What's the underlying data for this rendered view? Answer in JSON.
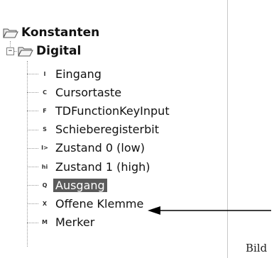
{
  "tree": {
    "root": {
      "label": "Konstanten",
      "expander": ""
    },
    "group": {
      "label": "Digital",
      "expander": "−"
    },
    "items": [
      {
        "icon_text": "I",
        "label": "Eingang"
      },
      {
        "icon_text": "C",
        "label": "Cursortaste"
      },
      {
        "icon_text": "F",
        "label": "TDFunctionKeyInput"
      },
      {
        "icon_text": "S",
        "label": "Schieberegisterbit"
      },
      {
        "icon_text": "I>",
        "label": "Zustand 0 (low)"
      },
      {
        "icon_text": "hi",
        "label": "Zustand 1 (high)"
      },
      {
        "icon_text": "Q",
        "label": "Ausgang",
        "selected": true
      },
      {
        "icon_text": "X",
        "label": "Offene Klemme"
      },
      {
        "icon_text": "M",
        "label": "Merker"
      }
    ]
  },
  "caption": "Bild",
  "colors": {
    "selection": "#5a5a5a",
    "tree_line": "#9a9a9a"
  }
}
